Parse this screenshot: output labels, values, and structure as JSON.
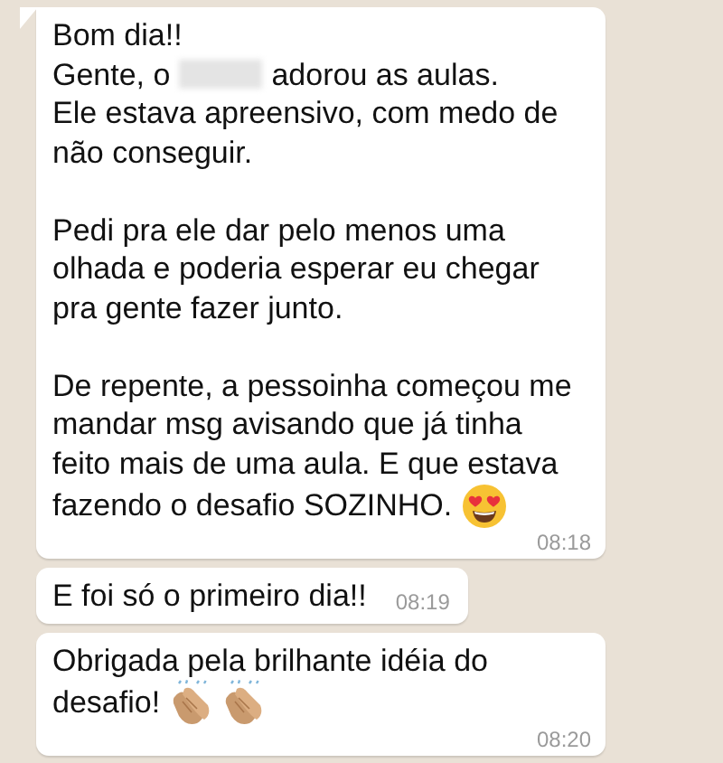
{
  "messages": [
    {
      "time": "08:18",
      "inline_time": false,
      "tail": true,
      "paragraphs": [
        [
          [
            {
              "kind": "text",
              "text": "Bom dia!!"
            }
          ],
          [
            {
              "kind": "text",
              "text": "Gente, o"
            },
            {
              "kind": "redacted"
            },
            {
              "kind": "text",
              "text": "adorou as aulas."
            }
          ],
          [
            {
              "kind": "text",
              "text": "Ele estava apreensivo, com medo de"
            }
          ],
          [
            {
              "kind": "text",
              "text": "não conseguir."
            }
          ]
        ],
        [
          [
            {
              "kind": "text",
              "text": "Pedi pra ele dar pelo menos uma"
            }
          ],
          [
            {
              "kind": "text",
              "text": "olhada e poderia esperar eu chegar"
            }
          ],
          [
            {
              "kind": "text",
              "text": "pra gente fazer junto."
            }
          ]
        ],
        [
          [
            {
              "kind": "text",
              "text": "De repente, a pessoinha começou me"
            }
          ],
          [
            {
              "kind": "text",
              "text": "mandar msg avisando que já tinha"
            }
          ],
          [
            {
              "kind": "text",
              "text": "feito mais de uma aula. E que estava"
            }
          ],
          [
            {
              "kind": "text",
              "text": "fazendo o desafio SOZINHO."
            },
            {
              "kind": "heart-eyes-emoji"
            }
          ]
        ]
      ]
    },
    {
      "time": "08:19",
      "inline_time": true,
      "tail": false,
      "paragraphs": [
        [
          [
            {
              "kind": "text",
              "text": "E foi só o primeiro dia!!"
            }
          ]
        ]
      ]
    },
    {
      "time": "08:20",
      "inline_time": false,
      "tail": false,
      "paragraphs": [
        [
          [
            {
              "kind": "text",
              "text": "Obrigada pela brilhante idéia do"
            }
          ],
          [
            {
              "kind": "text",
              "text": "desafio!"
            },
            {
              "kind": "clap-emoji"
            },
            {
              "kind": "clap-emoji"
            }
          ]
        ]
      ]
    }
  ]
}
